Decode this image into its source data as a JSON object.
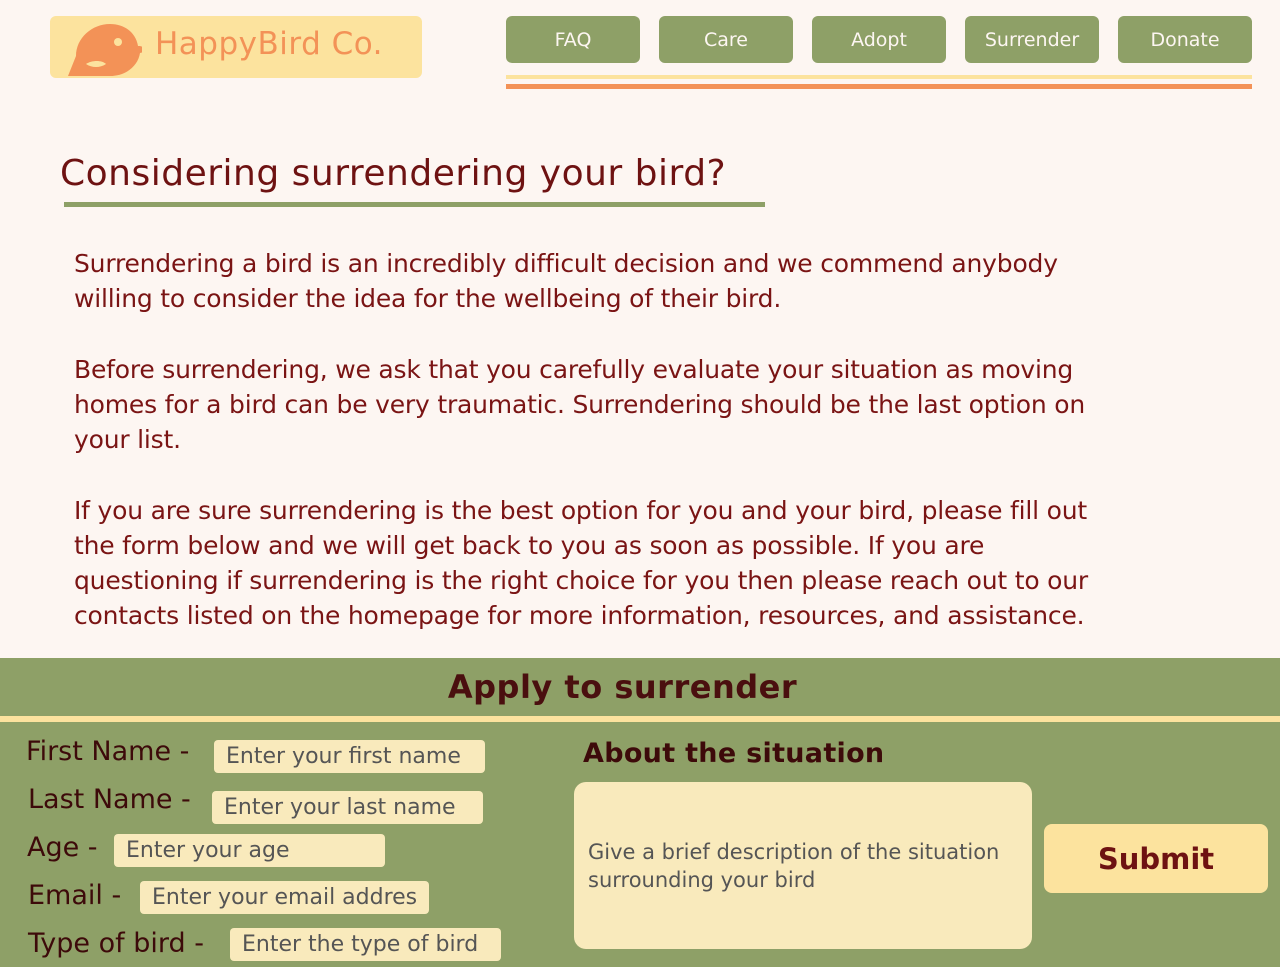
{
  "header": {
    "brand": "HappyBird Co.",
    "nav": [
      "FAQ",
      "Care",
      "Adopt",
      "Surrender",
      "Donate"
    ]
  },
  "main": {
    "title": "Considering surrendering your bird?",
    "paragraphs": [
      "Surrendering a bird is an incredibly difficult decision and we commend anybody willing to consider the idea for the wellbeing of their bird.",
      "Before surrendering, we ask that you carefully evaluate your situation as moving homes for a bird can be very traumatic. Surrendering should be the last option on your list.",
      "If you are sure surrendering is the best option for you and your bird, please fill out the form below and we will get back to you as soon as possible. If you are questioning if surrendering is the right choice for you then please reach out to our contacts listed on the homepage for more information, resources, and assistance."
    ]
  },
  "form": {
    "title": "Apply to surrender",
    "fields": [
      {
        "label": "First Name -",
        "placeholder": "Enter your first name"
      },
      {
        "label": "Last Name -",
        "placeholder": "Enter your last name"
      },
      {
        "label": "Age -",
        "placeholder": "Enter your age"
      },
      {
        "label": "Email -",
        "placeholder": "Enter your email address"
      },
      {
        "label": "Type of bird -",
        "placeholder": "Enter the type of bird"
      }
    ],
    "about_label": "About the situation",
    "about_placeholder": "Give a brief description of the situation surrounding your bird",
    "submit_label": "Submit"
  },
  "colors": {
    "background": "#fdf6f2",
    "nav": "#8ea067",
    "accent_yellow": "#fce39e",
    "accent_orange": "#f39257",
    "text": "#6e1212"
  },
  "icons": {
    "logo": "bird-icon"
  }
}
